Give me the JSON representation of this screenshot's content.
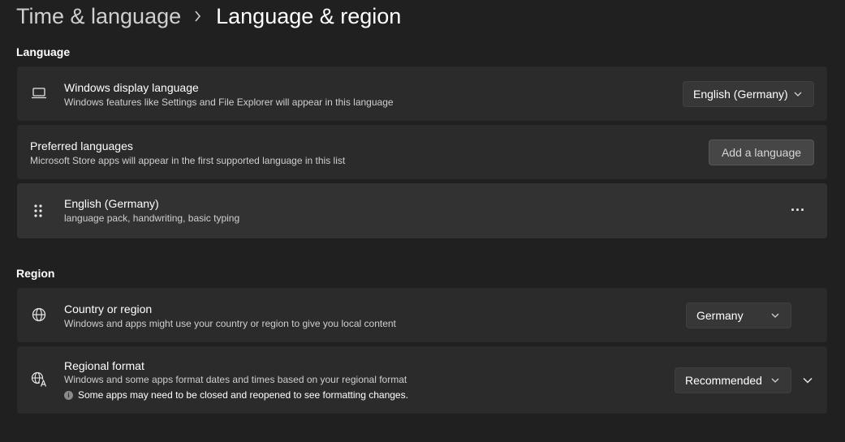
{
  "breadcrumb": {
    "parent": "Time & language",
    "current": "Language & region"
  },
  "language_section": {
    "title": "Language",
    "display_language": {
      "icon": "laptop-icon",
      "title": "Windows display language",
      "description": "Windows features like Settings and File Explorer will appear in this language",
      "value": "English (Germany)"
    },
    "preferred_languages": {
      "title": "Preferred languages",
      "description": "Microsoft Store apps will appear in the first supported language in this list",
      "button_label": "Add a language"
    },
    "languages": [
      {
        "icon": "drag-handle-icon",
        "name": "English (Germany)",
        "features": "language pack, handwriting, basic typing",
        "more_label": "···"
      }
    ]
  },
  "region_section": {
    "title": "Region",
    "country": {
      "icon": "globe-icon",
      "title": "Country or region",
      "description": "Windows and apps might use your country or region to give you local content",
      "value": "Germany"
    },
    "regional_format": {
      "icon": "regional-format-icon",
      "title": "Regional format",
      "description": "Windows and some apps format dates and times based on your regional format",
      "notice": "Some apps may need to be closed and reopened to see formatting changes.",
      "notice_icon_glyph": "i",
      "value": "Recommended"
    }
  },
  "colors": {
    "background": "#202020",
    "card": "#2b2b2b",
    "card_highlight": "#323232"
  }
}
